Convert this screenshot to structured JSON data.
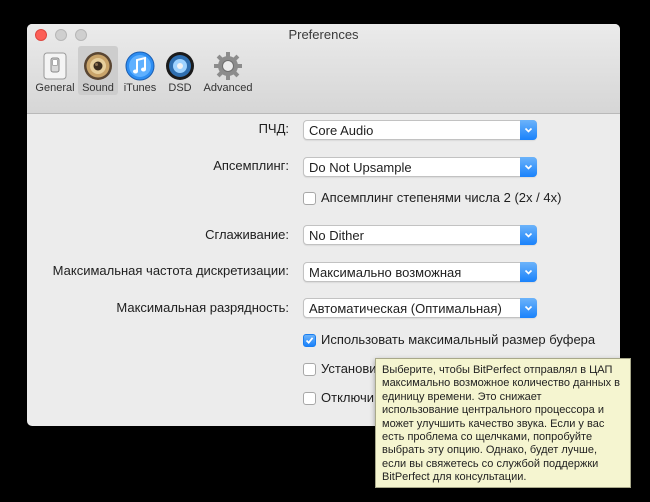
{
  "window": {
    "title": "Preferences"
  },
  "toolbar": {
    "tabs": [
      {
        "label": "General",
        "icon": "switch-icon"
      },
      {
        "label": "Sound",
        "icon": "speaker-icon",
        "active": true
      },
      {
        "label": "iTunes",
        "icon": "itunes-icon"
      },
      {
        "label": "DSD",
        "icon": "disc-icon"
      },
      {
        "label": "Advanced",
        "icon": "gear-icon"
      }
    ]
  },
  "settings": {
    "dac": {
      "label": "ПЧД:",
      "value": "Core Audio"
    },
    "upsampling": {
      "label": "Апсемплинг:",
      "value": "Do Not Upsample"
    },
    "upsampling_power2": {
      "label": "Апсемплинг степенями числа 2 (2x / 4x)",
      "checked": false
    },
    "dither": {
      "label": "Сглаживание:",
      "value": "No Dither"
    },
    "max_rate": {
      "label": "Максимальная частота дискретизации:",
      "value": "Максимально возможная"
    },
    "max_bits": {
      "label": "Максимальная разрядность:",
      "value": "Автоматическая (Оптимальная)"
    },
    "max_buffer": {
      "label": "Использовать максимальный размер буфера",
      "checked": true
    },
    "install": {
      "label": "Установи",
      "checked": false
    },
    "disable": {
      "label": "Отключи",
      "checked": false
    }
  },
  "tooltip": {
    "lines": [
      "Выберите, чтобы BitPerfect отправлял в ЦАП",
      "максимально возможное количество данных в",
      "единицу времени. Это снижает",
      "использование центрального процессора и",
      "может улучшить качество звука. Если у вас",
      "есть проблема со щелчками, попробуйте",
      "выбрать эту опцию. Однако, будет лучше,",
      "если вы свяжетесь со службой поддержки",
      "BitPerfect для консультации."
    ]
  },
  "colors": {
    "accent": "#1a82fb",
    "close": "#fc5f57",
    "tooltip_bg": "#f5f5d0"
  }
}
